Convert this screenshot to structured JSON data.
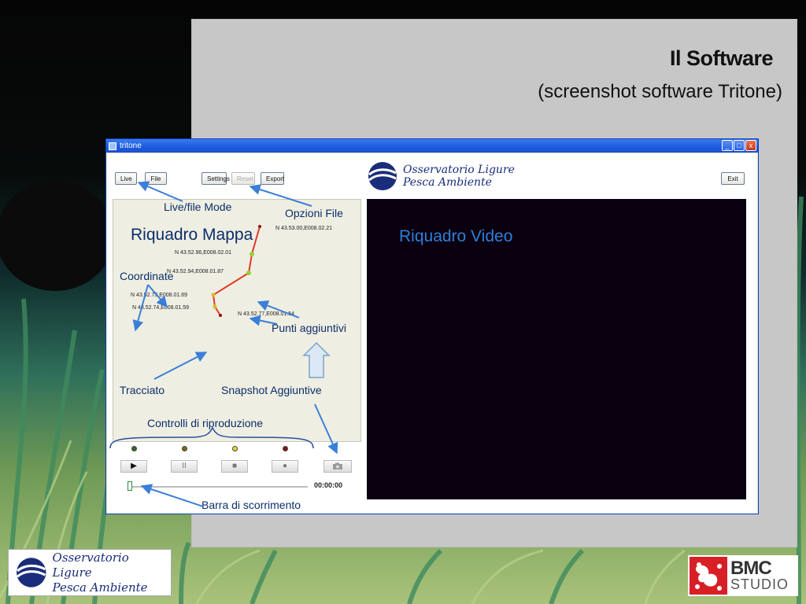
{
  "slide": {
    "title": "Il Software",
    "subtitle": "(screenshot software Tritone)"
  },
  "window": {
    "title": "tritone",
    "minimize_glyph": "_",
    "maximize_glyph": "□",
    "close_glyph": "x"
  },
  "toolbar": {
    "live_label": "Live",
    "file_label": "File",
    "settings_label": "Settings",
    "reset_label": "Reset",
    "export_label": "Export",
    "exit_label": "Exit"
  },
  "app_logo": {
    "line1": "Osservatorio Ligure",
    "line2": "Pesca Ambiente"
  },
  "map": {
    "coordinates": [
      "N 43.53.00,E008.02.21",
      "N 43.52.96,E008.02.01",
      "N 43.52.94,E008.01.87",
      "N 43.52.73,E008.01.69",
      "N 43.52.74,E008.01.59",
      "N 43.52.77,E008.01.54"
    ]
  },
  "controls": {
    "play_glyph": "▶",
    "pause_glyph": "II",
    "stop_glyph": "■",
    "record_glyph": "●",
    "time": "00:00:00",
    "slider_position": 0.0,
    "led_colors": [
      "#2e6b1e",
      "#7a6a1a",
      "#e8d82a",
      "#8a1010"
    ]
  },
  "annotations": {
    "live_file_mode": "Live/file Mode",
    "opzioni_file": "Opzioni File",
    "riquadro_mappa": "Riquadro Mappa",
    "riquadro_video": "Riquadro Video",
    "coordinate": "Coordinate",
    "punti_aggiuntivi": "Punti aggiuntivi",
    "tracciato": "Tracciato",
    "snapshot_aggiuntive": "Snapshot Aggiuntive",
    "controlli_riproduzione": "Controlli di riproduzione",
    "barra_scorrimento": "Barra di scorrimento"
  },
  "footer": {
    "logo_line1": "Osservatorio Ligure",
    "logo_line2": "Pesca Ambiente",
    "bmc_main": "BMC",
    "bmc_sub": "STUDIO"
  },
  "colors": {
    "annotation_arrow": "#3a7fd8",
    "track_line": "#e03a2a",
    "video_bg": "#0a0010",
    "slide_panel": "#c7c7c7"
  }
}
